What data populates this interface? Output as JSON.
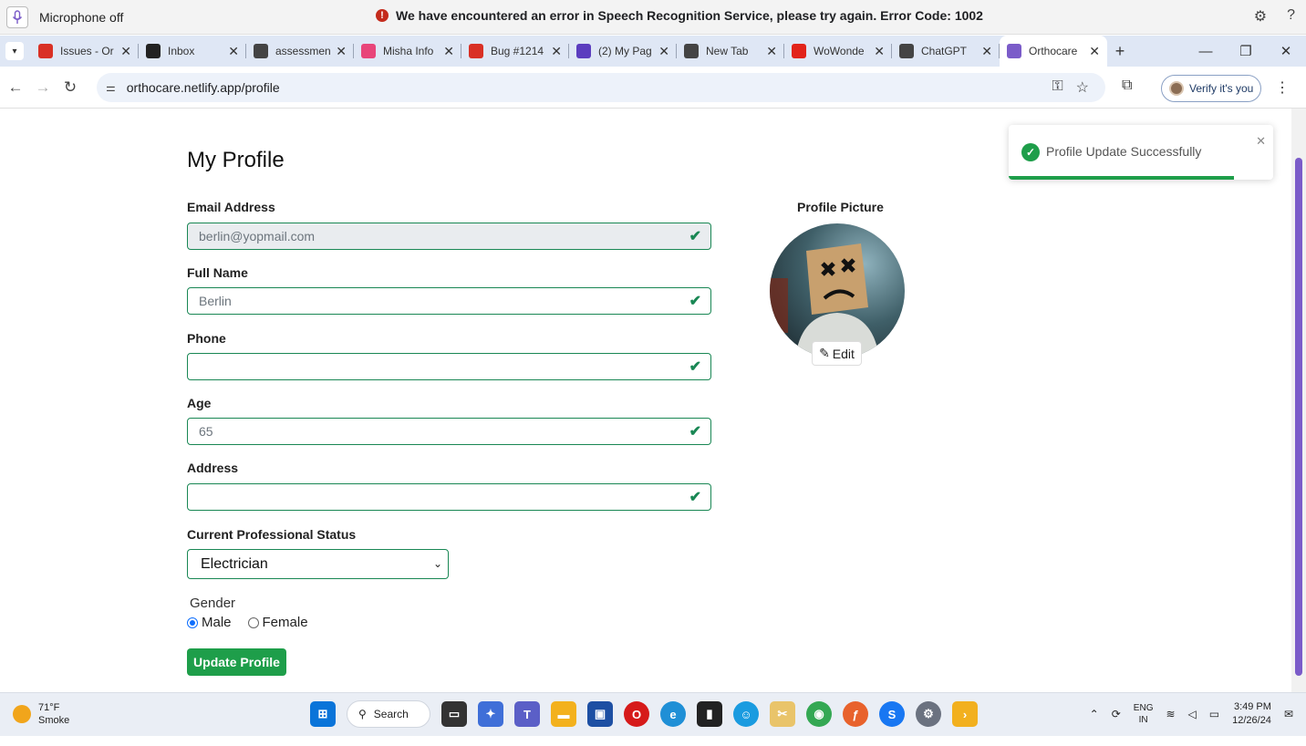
{
  "speech_bar": {
    "mic_status": "Microphone off",
    "error_text": "We have encountered an error in Speech Recognition Service, please try again. Error Code: 1002"
  },
  "tabs": [
    {
      "label": "Issues - Or",
      "icon": "bug-tracker-icon",
      "color": "#d93025"
    },
    {
      "label": "Inbox",
      "icon": "inbox-icon",
      "color": "#222222"
    },
    {
      "label": "assessmen",
      "icon": "globe-icon",
      "color": "#444444"
    },
    {
      "label": "Misha Info",
      "icon": "misha-icon",
      "color": "#e8457a"
    },
    {
      "label": "Bug #1214",
      "icon": "bug-tracker-icon",
      "color": "#d93025"
    },
    {
      "label": "(2) My Pag",
      "icon": "m-icon",
      "color": "#5b3dbf"
    },
    {
      "label": "New Tab",
      "icon": "chrome-icon",
      "color": "#444444"
    },
    {
      "label": "WoWonde",
      "icon": "wowonder-icon",
      "color": "#e2231a"
    },
    {
      "label": "ChatGPT",
      "icon": "chatgpt-icon",
      "color": "#444444"
    },
    {
      "label": "Orthocare",
      "icon": "orthocare-icon",
      "color": "#7b5cc9",
      "active": true
    }
  ],
  "address_bar": {
    "url": "orthocare.netlify.app/profile",
    "verify_label": "Verify it's you"
  },
  "page": {
    "title": "My Profile",
    "fields": {
      "email": {
        "label": "Email Address",
        "value": "berlin@yopmail.com"
      },
      "full_name": {
        "label": "Full Name",
        "value": "Berlin"
      },
      "phone": {
        "label": "Phone",
        "value": ""
      },
      "age": {
        "label": "Age",
        "value": "65"
      },
      "address": {
        "label": "Address",
        "value": ""
      }
    },
    "status": {
      "label": "Current Professional Status",
      "selected": "Electrician"
    },
    "gender": {
      "label": "Gender",
      "options": [
        "Male",
        "Female"
      ],
      "selected": "Male"
    },
    "update_button": "Update Profile",
    "profile_picture_label": "Profile Picture",
    "edit_label": "Edit"
  },
  "toast": {
    "message": "Profile Update Successfully",
    "progress": 0.85
  },
  "taskbar": {
    "temperature": "71°F",
    "condition": "Smoke",
    "search_label": "Search",
    "lang_top": "ENG",
    "lang_bottom": "IN",
    "time": "3:49 PM",
    "date": "12/26/24"
  },
  "colors": {
    "accent_green": "#198754",
    "button_green": "#1e9e4a",
    "scrollbar": "#7b5cc9",
    "tab_strip": "#dfe7f5"
  }
}
